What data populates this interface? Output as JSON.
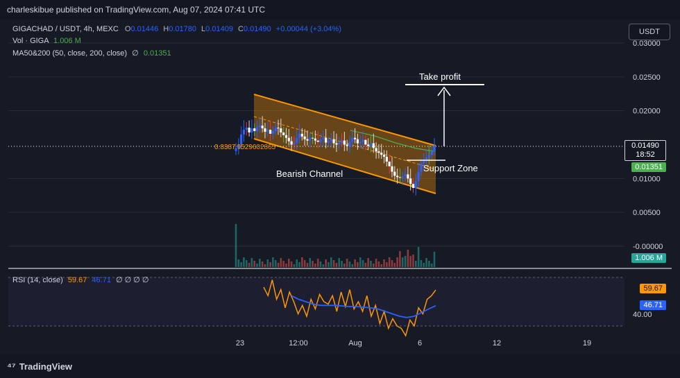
{
  "header": {
    "published": "charleskibue published on TradingView.com, Aug 07, 2024 07:41 UTC"
  },
  "legend": {
    "symbol": "GIGACHAD / USDT, 4h, MEXC",
    "o_label": "O",
    "o_value": "0.01446",
    "h_label": "H",
    "h_value": "0.01780",
    "l_label": "L",
    "l_value": "0.01409",
    "c_label": "C",
    "c_value": "0.01490",
    "change": "+0.00044 (+3.04%)",
    "vol_label": "Vol · GIGA",
    "vol_value": "1.006 M",
    "ma_label": "MA50&200 (50, close, 200, close)",
    "ma_null": "∅",
    "ma_value": "0.01351"
  },
  "currency_button": "USDT",
  "price_axis": {
    "ticks": [
      "0.03000",
      "0.02500",
      "0.02000",
      "0.01000",
      "0.00500",
      "-0.00000"
    ],
    "ticks_numeric": [
      0.03,
      0.025,
      0.02,
      0.01,
      0.005,
      0.0
    ]
  },
  "badges": {
    "price": "0.01490",
    "countdown": "18:52",
    "ma": "0.01351",
    "volume": "1.006 M",
    "rsi": "59.67",
    "rsi_ma": "46.71"
  },
  "rsi": {
    "label": "RSI (14, close)",
    "value": "59.67",
    "ma_value": "46.71",
    "nulls": "∅ ∅ ∅ ∅",
    "axis_tick": "40.00"
  },
  "annotations": {
    "take_profit": "Take profit",
    "support_zone": "Support Zone",
    "bearish_channel": "Bearish Channel",
    "fib_label": "0.8387",
    "fib_label_tail": "9529602865"
  },
  "time_axis": [
    "23",
    "12:00",
    "Aug",
    "6",
    "12",
    "19"
  ],
  "footer": {
    "brand": "TradingView"
  },
  "colors": {
    "background": "#161a25",
    "bull": "#2962ff",
    "bear": "#ffffff",
    "channel": "#ff9800",
    "rsi_line": "#ff9800",
    "rsi_ma": "#2962ff",
    "ma_line": "#4caf50"
  },
  "chart_data": {
    "type": "candlestick",
    "title": "GIGACHAD / USDT, 4h, MEXC",
    "ylim": [
      0.0,
      0.031
    ],
    "close": [
      0.0145,
      0.015,
      0.0165,
      0.0172,
      0.0175,
      0.0168,
      0.0174,
      0.017,
      0.0176,
      0.0178,
      0.0174,
      0.0169,
      0.0172,
      0.0166,
      0.017,
      0.0175,
      0.0174,
      0.0168,
      0.0164,
      0.016,
      0.0155,
      0.015,
      0.0153,
      0.016,
      0.0166,
      0.0162,
      0.0158,
      0.0156,
      0.016,
      0.0159,
      0.0156,
      0.0154,
      0.0158,
      0.016,
      0.0153,
      0.0155,
      0.0158,
      0.0152,
      0.015,
      0.0153,
      0.0156,
      0.015,
      0.0148,
      0.0154,
      0.016,
      0.0158,
      0.0152,
      0.0154,
      0.0157,
      0.015,
      0.0148,
      0.0152,
      0.0145,
      0.014,
      0.0138,
      0.0135,
      0.0132,
      0.0125,
      0.0118,
      0.011,
      0.0104,
      0.0102,
      0.0101,
      0.0103,
      0.0106,
      0.01,
      0.0092,
      0.0086,
      0.0096,
      0.011,
      0.0122,
      0.0128,
      0.0131,
      0.0135,
      0.014,
      0.0149
    ],
    "volume_max_label": "1.006 M",
    "rsi_close": 59.67,
    "rsi_ma": 46.71
  }
}
